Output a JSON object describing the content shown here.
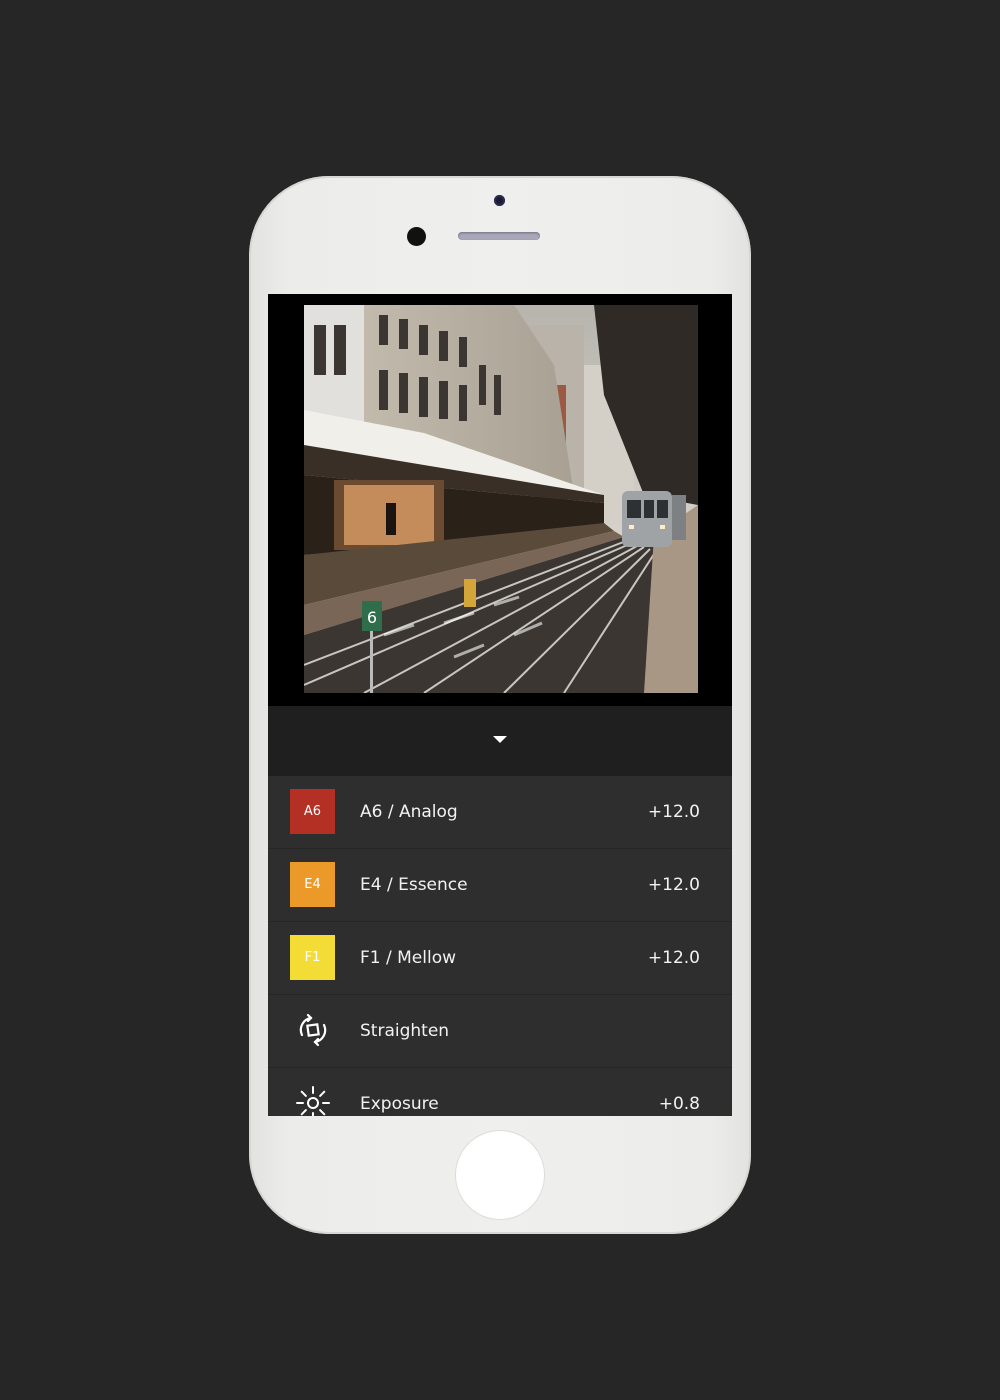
{
  "device": {
    "icons": [
      "camera-dot",
      "proximity-sensor",
      "speaker-grille",
      "home-button"
    ]
  },
  "editor": {
    "collapse_icon": "triangle-down-icon",
    "presets": [
      {
        "code": "A6",
        "label": "A6 / Analog",
        "value": "+12.0",
        "color": "#b53024"
      },
      {
        "code": "E4",
        "label": "E4 / Essence",
        "value": "+12.0",
        "color": "#eb9a2a"
      },
      {
        "code": "F1",
        "label": "F1 / Mellow",
        "value": "+12.0",
        "color": "#f3dc36"
      }
    ],
    "tools": [
      {
        "label": "Straighten",
        "value": "",
        "icon": "straighten-icon"
      },
      {
        "label": "Exposure",
        "value": "+0.8",
        "icon": "sun-icon"
      }
    ]
  }
}
